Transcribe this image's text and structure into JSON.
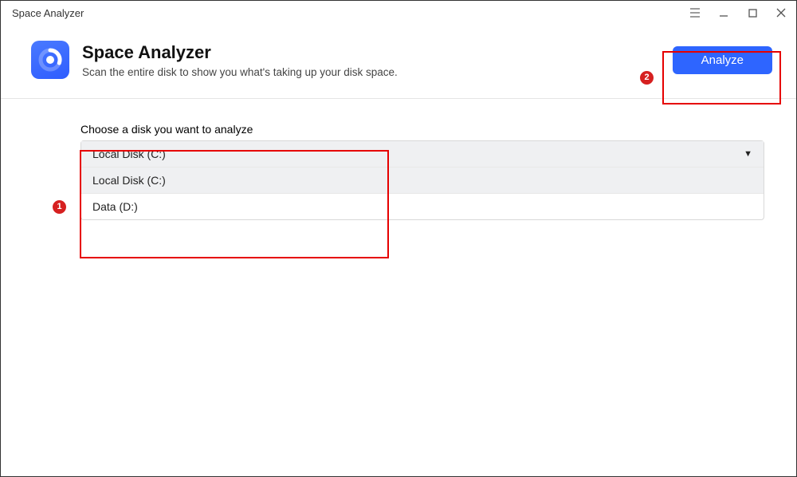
{
  "window": {
    "title": "Space Analyzer"
  },
  "header": {
    "title": "Space Analyzer",
    "description": "Scan the entire disk to show you what's taking up your disk space.",
    "analyzeLabel": "Analyze"
  },
  "content": {
    "chooseLabel": "Choose a disk you want to analyze",
    "selectedDisk": "Local Disk (C:)",
    "options": [
      "Local Disk (C:)",
      "Data (D:)"
    ]
  },
  "annotations": {
    "num1": "1",
    "num2": "2"
  }
}
